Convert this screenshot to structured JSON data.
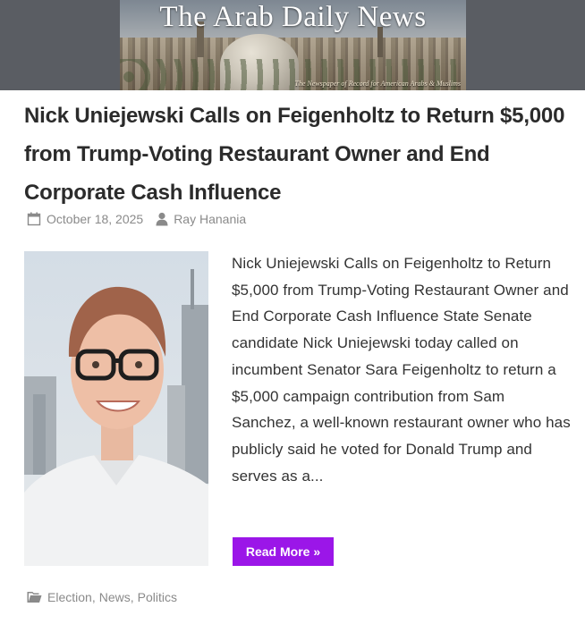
{
  "site": {
    "title": "The Arab Daily News",
    "tagline": "The Newspaper of Record for American Arabs & Muslims"
  },
  "post": {
    "headline": "Nick Uniejewski Calls on Feigenholtz to Return $5,000 from Trump-Voting Restaurant Owner and End Corporate Cash Influence",
    "date": "October 18, 2025",
    "author": "Ray Hanania",
    "excerpt": "Nick Uniejewski Calls on Feigenholtz to Return $5,000 from Trump-Voting Restaurant Owner and End Corporate Cash Influence State Senate candidate Nick Uniejewski today called on incumbent Senator Sara Feigenholtz to return a $5,000 campaign contribution from Sam Sanchez, a well-known restaurant owner who has publicly said he voted for Donald Trump and serves as a...",
    "read_more": "Read More »",
    "categories": [
      "Election",
      "News",
      "Politics"
    ]
  },
  "icons": {
    "date": "calendar-icon",
    "author": "user-icon",
    "categories": "folder-icon"
  },
  "colors": {
    "accent": "#9b16e8",
    "header_bg": "#5a5d63",
    "meta_text": "#8a8a8a"
  }
}
